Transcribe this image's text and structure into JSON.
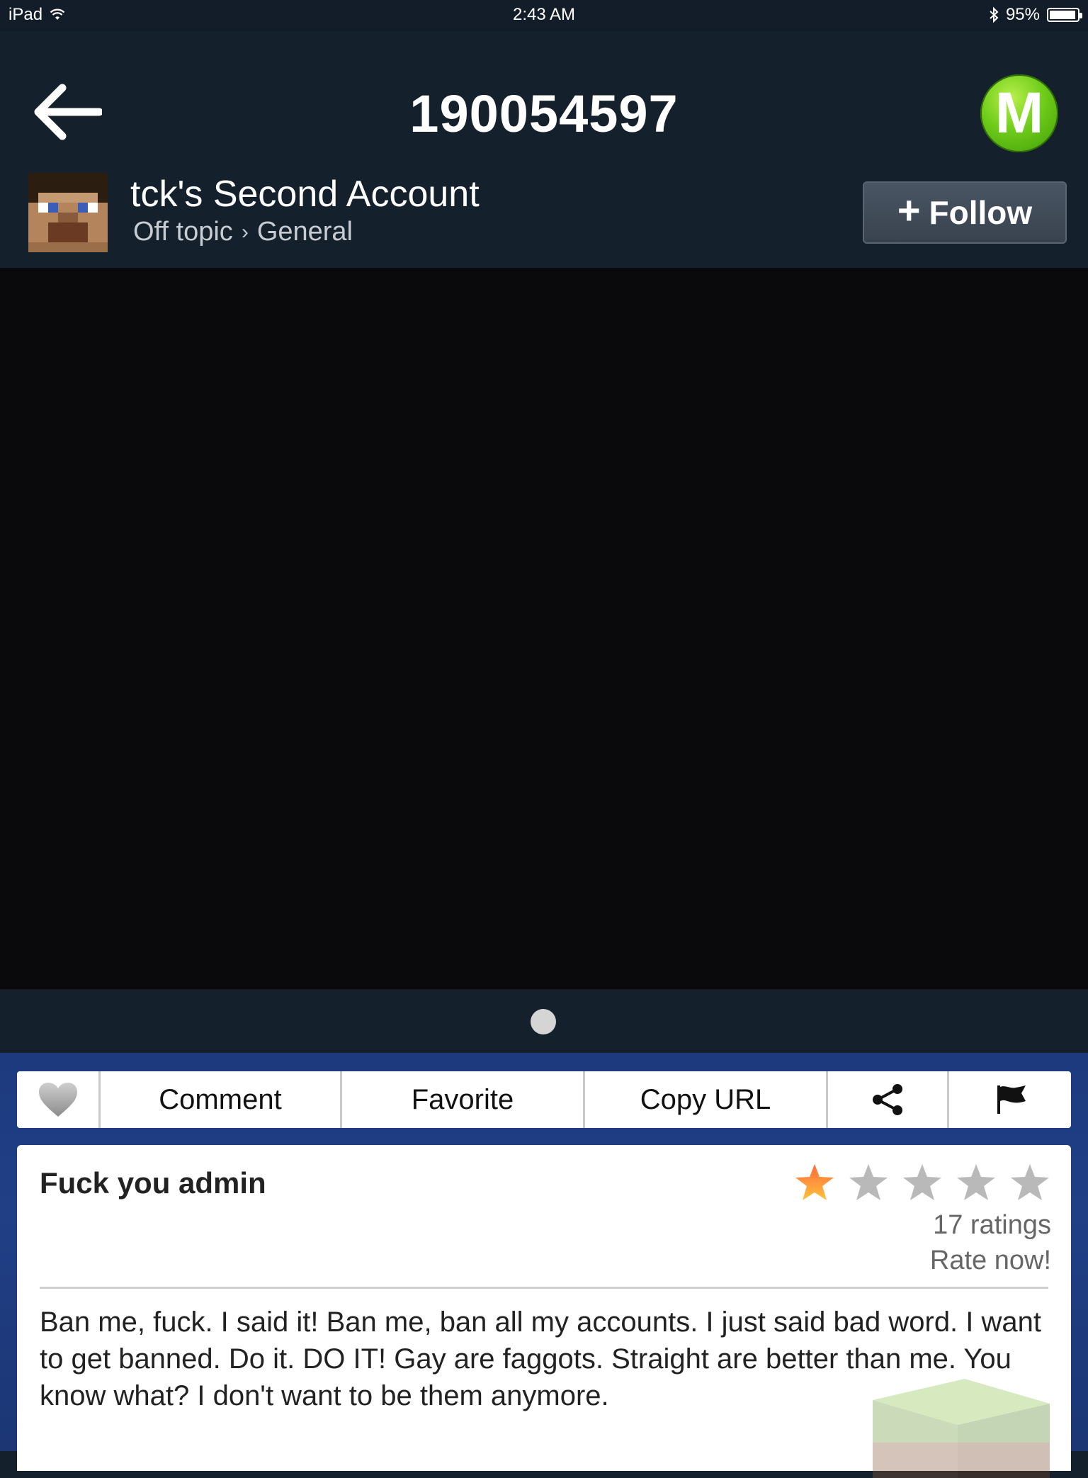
{
  "status_bar": {
    "device": "iPad",
    "time": "2:43 AM",
    "battery_text": "95%",
    "battery_level": 0.95
  },
  "nav": {
    "title": "190054597",
    "logo_letter": "M"
  },
  "author": {
    "name": "tck's Second Account",
    "category": "Off topic",
    "separator": "›",
    "subcategory": "General",
    "follow_plus": "+",
    "follow_label": "Follow"
  },
  "pager": {
    "current_page": 1,
    "total_pages": 1
  },
  "actions": {
    "comment": "Comment",
    "favorite": "Favorite",
    "copy_url": "Copy URL"
  },
  "post": {
    "title": "Fuck you admin",
    "rating": 1,
    "rating_max": 5,
    "rating_count": "17 ratings",
    "rate_now": "Rate now!",
    "body": "Ban me, fuck. I said it! Ban me, ban all my accounts. I just said bad word. I want to get banned. Do it. DO IT! Gay are faggots. Straight are better than me. You know what? I don't want to be them anymore."
  },
  "colors": {
    "nav_bg": "#15202d",
    "accent_green": "#6fcc1a",
    "content_bg": "#1f3d82",
    "star_active": "#f7a03c",
    "star_inactive": "#b9b9b9"
  }
}
